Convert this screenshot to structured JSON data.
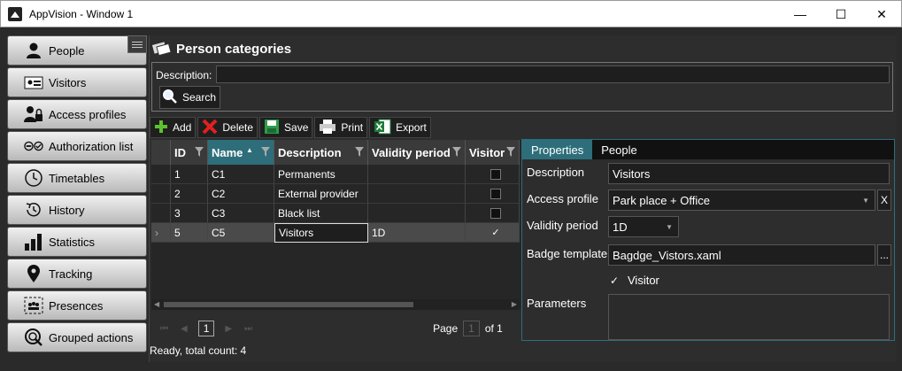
{
  "window": {
    "title": "AppVision - Window 1",
    "minimize": "—",
    "maximize": "☐",
    "close": "✕"
  },
  "sidebar": {
    "items": [
      {
        "label": "People",
        "icon": "person-icon"
      },
      {
        "label": "Visitors",
        "icon": "visitor-card-icon"
      },
      {
        "label": "Access profiles",
        "icon": "access-profile-icon"
      },
      {
        "label": "Authorization list",
        "icon": "authorization-list-icon"
      },
      {
        "label": "Timetables",
        "icon": "clock-icon"
      },
      {
        "label": "History",
        "icon": "history-icon"
      },
      {
        "label": "Statistics",
        "icon": "bar-chart-icon"
      },
      {
        "label": "Tracking",
        "icon": "location-pin-icon"
      },
      {
        "label": "Presences",
        "icon": "presences-icon"
      },
      {
        "label": "Grouped actions",
        "icon": "grouped-actions-icon"
      }
    ]
  },
  "main": {
    "title": "Person categories",
    "search": {
      "description_label": "Description:",
      "description_value": "",
      "search_label": "Search"
    },
    "toolbar": {
      "add": "Add",
      "delete": "Delete",
      "save": "Save",
      "print": "Print",
      "export": "Export"
    },
    "grid": {
      "columns": [
        "ID",
        "Name",
        "Description",
        "Validity period",
        "Visitor"
      ],
      "rows": [
        {
          "id": "1",
          "name": "C1",
          "description": "Permanents",
          "validity": "",
          "visitor": ""
        },
        {
          "id": "2",
          "name": "C2",
          "description": "External provider",
          "validity": "",
          "visitor": ""
        },
        {
          "id": "3",
          "name": "C3",
          "description": "Black list",
          "validity": "",
          "visitor": ""
        },
        {
          "id": "5",
          "name": "C5",
          "description": "Visitors",
          "validity": "1D",
          "visitor": "✓"
        }
      ],
      "row_marker": "›"
    },
    "pager": {
      "first": "⏮",
      "prev": "◀",
      "current": "1",
      "next": "▶",
      "last": "⏭",
      "page_label": "Page",
      "page_value": "1",
      "of_label": "of 1"
    },
    "status": "Ready, total count: 4"
  },
  "properties": {
    "tabs": [
      "Properties",
      "People"
    ],
    "description_label": "Description",
    "description_value": "Visitors",
    "access_profile_label": "Access profile",
    "access_profile_value": "Park place + Office",
    "access_profile_clear": "X",
    "validity_label": "Validity period",
    "validity_value": "1D",
    "badge_label": "Badge template",
    "badge_value": "Bagdge_Vistors.xaml",
    "badge_browse": "...",
    "visitor_label": "Visitor",
    "visitor_check": "✓",
    "parameters_label": "Parameters",
    "parameters_value": ""
  },
  "colors": {
    "accent": "#2d6e7a",
    "background": "#2b2b2b"
  }
}
